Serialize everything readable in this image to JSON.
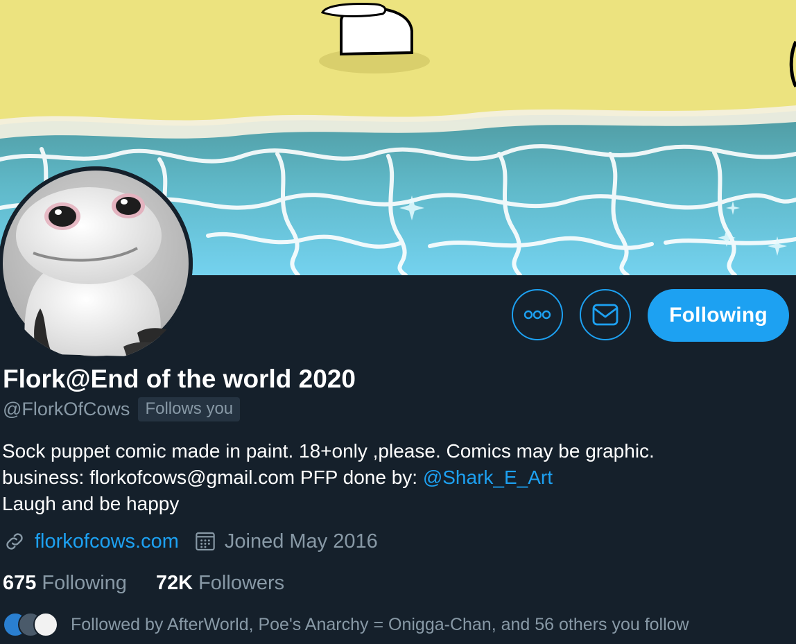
{
  "profile": {
    "display_name": "Flork@End of the world 2020",
    "handle": "@FlorkOfCows",
    "follows_you_badge": "Follows you",
    "bio_line1": "Sock puppet comic made in paint. 18+only ,please. Comics may be graphic.",
    "bio_line2_text": "business: florkofcows@gmail.com PFP done by: ",
    "bio_line2_mention": "@Shark_E_Art",
    "bio_line3": "Laugh and be happy",
    "website": "florkofcows.com",
    "joined": "Joined May 2016"
  },
  "actions": {
    "more_icon": "more-horizontal-icon",
    "message_icon": "envelope-icon",
    "follow_button_label": "Following"
  },
  "stats": {
    "following_count": "675",
    "following_label": "Following",
    "followers_count": "72K",
    "followers_label": "Followers"
  },
  "followed_by": {
    "text": "Followed by AfterWorld, Poe's Anarchy = Onigga-Chan, and 56 others you follow"
  },
  "colors": {
    "background": "#15202b",
    "accent": "#1da1f2",
    "secondary_text": "#8899a6",
    "primary_text": "#ffffff"
  },
  "icons": {
    "website": "link-icon",
    "joined": "calendar-icon"
  }
}
